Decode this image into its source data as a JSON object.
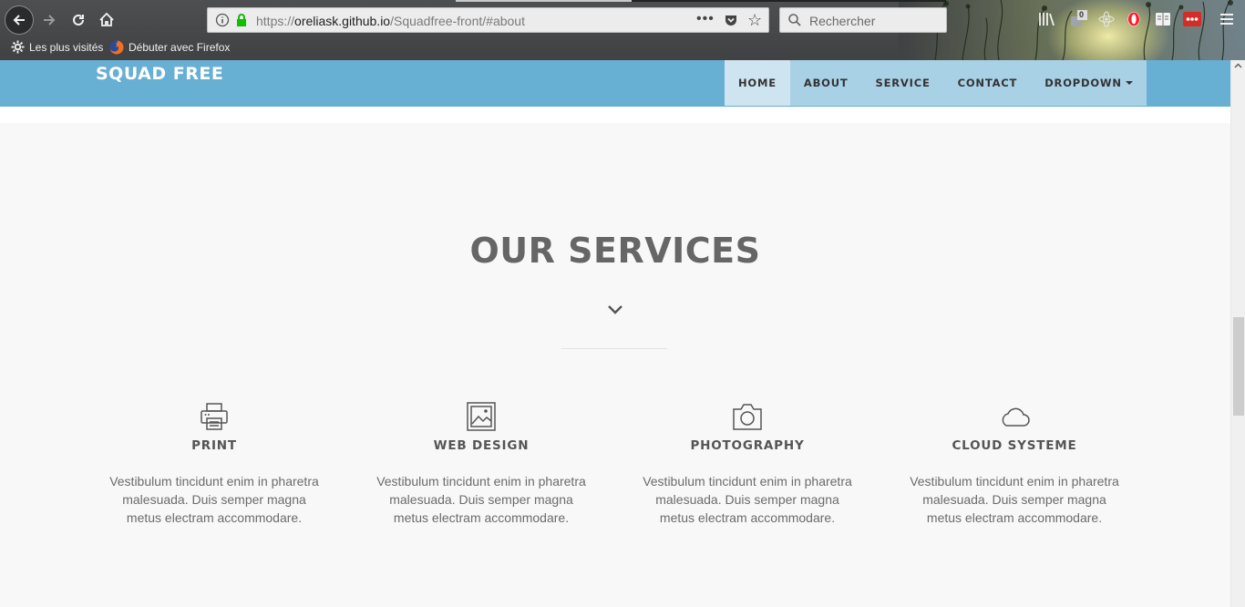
{
  "browser": {
    "url_scheme": "https://",
    "url_host": "oreliask.github.io",
    "url_path": "/Squadfree-front/#about",
    "page_actions": "•••",
    "search_placeholder": "Rechercher",
    "counter_badge": "0",
    "bookmarks": [
      {
        "label": "Les plus visités",
        "icon": "gear-icon"
      },
      {
        "label": "Débuter avec Firefox",
        "icon": "firefox-icon"
      }
    ]
  },
  "site": {
    "brand": "SQUAD FREE",
    "nav": [
      {
        "label": "HOME",
        "active": true
      },
      {
        "label": "ABOUT"
      },
      {
        "label": "SERVICE"
      },
      {
        "label": "CONTACT"
      },
      {
        "label": "DROPDOWN",
        "has_caret": true
      }
    ],
    "colors": {
      "navbar": "#67afd3",
      "menu": "#a9d1e6",
      "active": "#cfe4f1"
    }
  },
  "services_section": {
    "title": "OUR SERVICES",
    "items": [
      {
        "icon": "printer-icon",
        "title": "PRINT",
        "text": "Vestibulum tincidunt enim in pharetra malesuada. Duis semper magna metus electram accommodare."
      },
      {
        "icon": "image-icon",
        "title": "WEB DESIGN",
        "text": "Vestibulum tincidunt enim in pharetra malesuada. Duis semper magna metus electram accommodare."
      },
      {
        "icon": "camera-icon",
        "title": "PHOTOGRAPHY",
        "text": "Vestibulum tincidunt enim in pharetra malesuada. Duis semper magna metus electram accommodare."
      },
      {
        "icon": "cloud-icon",
        "title": "CLOUD SYSTEME",
        "text": "Vestibulum tincidunt enim in pharetra malesuada. Duis semper magna metus electram accommodare."
      }
    ]
  }
}
